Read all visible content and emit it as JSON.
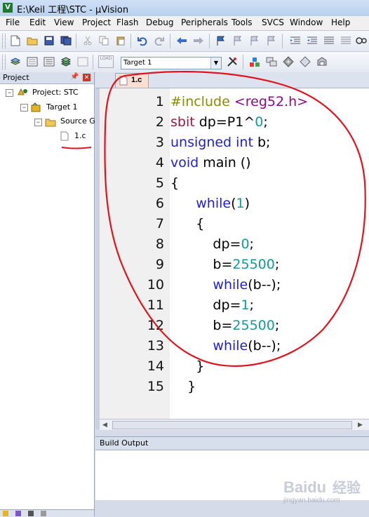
{
  "window": {
    "title": "E:\\Keil 工程\\STC - µVision",
    "app_icon": "V"
  },
  "menu": [
    "File",
    "Edit",
    "View",
    "Project",
    "Flash",
    "Debug",
    "Peripherals",
    "Tools",
    "SVCS",
    "Window",
    "Help"
  ],
  "toolbar": {
    "target_select": "Target 1",
    "load_label": "LOAD"
  },
  "project_panel": {
    "title": "Project",
    "tree": {
      "project": "Project: STC",
      "target": "Target 1",
      "group": "Source G",
      "file": "1.c"
    }
  },
  "editor": {
    "tab": "1.c",
    "line_numbers": [
      "1",
      "2",
      "3",
      "4",
      "5",
      "6",
      "7",
      "8",
      "9",
      "10",
      "11",
      "12",
      "13",
      "14",
      "15"
    ],
    "colors": {
      "keyword": "#1f1fd0",
      "preprocessor": "#8b8b00",
      "header": "#8b0a8b",
      "number": "#109a9a",
      "sbit": "#a0153e"
    }
  },
  "build_output": {
    "title": "Build Output"
  },
  "watermark": {
    "brand": "Baidu",
    "sub": "经验",
    "url": "jingyan.baidu.com"
  },
  "annotation": {
    "color": "#e0141e"
  }
}
